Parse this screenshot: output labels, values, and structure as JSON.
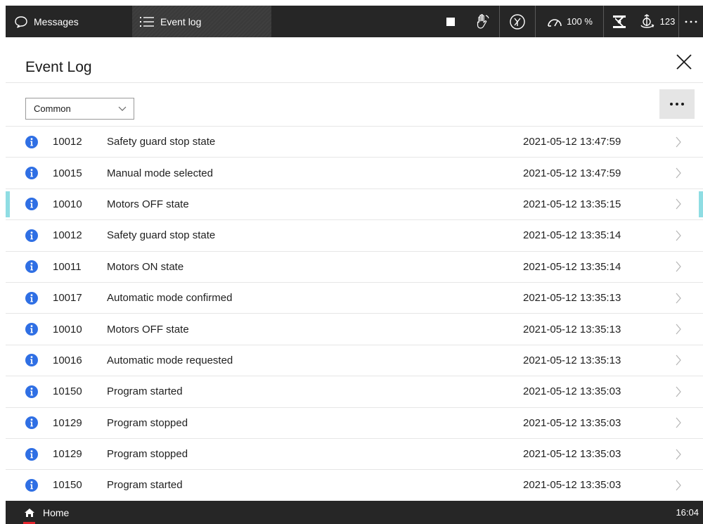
{
  "topbar": {
    "messages_label": "Messages",
    "eventlog_label": "Event log",
    "speed_value": "100 %",
    "tool_value": "123"
  },
  "header": {
    "title": "Event Log"
  },
  "filter": {
    "selected": "Common"
  },
  "events": [
    {
      "code": "10012",
      "description": "Safety guard stop state",
      "time": "2021-05-12 13:47:59",
      "type": "info"
    },
    {
      "code": "10015",
      "description": "Manual mode selected",
      "time": "2021-05-12 13:47:59",
      "type": "info"
    },
    {
      "code": "10010",
      "description": "Motors OFF state",
      "time": "2021-05-12 13:35:15",
      "type": "info",
      "selected": true
    },
    {
      "code": "10012",
      "description": "Safety guard stop state",
      "time": "2021-05-12 13:35:14",
      "type": "info"
    },
    {
      "code": "10011",
      "description": "Motors ON state",
      "time": "2021-05-12 13:35:14",
      "type": "info"
    },
    {
      "code": "10017",
      "description": "Automatic mode confirmed",
      "time": "2021-05-12 13:35:13",
      "type": "info"
    },
    {
      "code": "10010",
      "description": "Motors OFF state",
      "time": "2021-05-12 13:35:13",
      "type": "info"
    },
    {
      "code": "10016",
      "description": "Automatic mode requested",
      "time": "2021-05-12 13:35:13",
      "type": "info"
    },
    {
      "code": "10150",
      "description": "Program started",
      "time": "2021-05-12 13:35:03",
      "type": "info"
    },
    {
      "code": "10129",
      "description": "Program stopped",
      "time": "2021-05-12 13:35:03",
      "type": "info"
    },
    {
      "code": "10129",
      "description": "Program stopped",
      "time": "2021-05-12 13:35:03",
      "type": "info"
    },
    {
      "code": "10150",
      "description": "Program started",
      "time": "2021-05-12 13:35:03",
      "type": "info"
    }
  ],
  "bottombar": {
    "home_label": "Home",
    "clock": "16:04"
  },
  "colors": {
    "bar_background": "#262626",
    "info_icon": "#2f6fe4",
    "selection_marker": "#8fdde3",
    "home_indicator": "#e3262e"
  }
}
